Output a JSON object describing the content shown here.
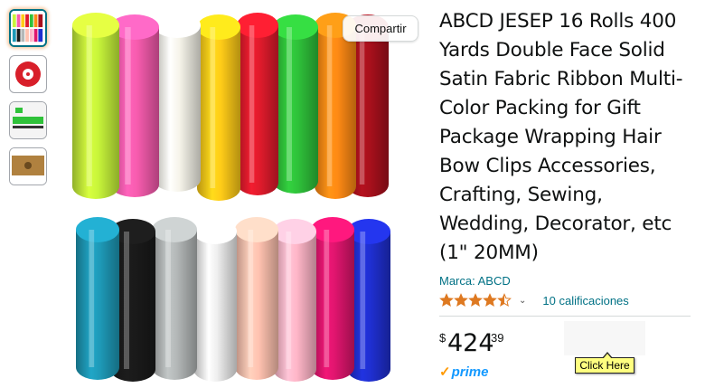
{
  "share": {
    "label": "Compartir"
  },
  "product": {
    "title": "ABCD JESEP 16 Rolls 400 Yards Double Face Solid Satin Fabric Ribbon Multi-Color Packing for Gift Package Wrapping Hair Bow Clips Accessories, Crafting, Sewing, Wedding, Decorator, etc (1\" 20MM)",
    "brand": "Marca: ABCD",
    "rating_value": 4.5,
    "rating_icon": "star-icon",
    "reviews": "10 calificaciones",
    "price_symbol": "$",
    "price_whole": "424",
    "price_fraction": "39",
    "prime_label": "prime",
    "prime_check": "✓"
  },
  "tooltip": {
    "label": "Click Here"
  },
  "thumbnails": [
    {
      "name": "thumbnail-ribbons",
      "active": true
    },
    {
      "name": "thumbnail-red-roll",
      "active": false
    },
    {
      "name": "thumbnail-ribbon-measure",
      "active": false
    },
    {
      "name": "thumbnail-package",
      "active": false
    }
  ],
  "colors": {
    "link": "#007185",
    "star": "#de7921",
    "prime": "#1399ff",
    "prime_check": "#ff9900",
    "top_rolls": [
      "#c8f53a",
      "#f75cae",
      "#f6f4ea",
      "#ffcc18",
      "#e11b2c",
      "#2fc23a",
      "#ff8a14",
      "#a8101c"
    ],
    "bottom_rolls": [
      "#1e9ab8",
      "#1a1a1a",
      "#b4b8b8",
      "#eeeeee",
      "#ffc2b0",
      "#ffb6c8",
      "#e0156e",
      "#1f2fd0"
    ]
  }
}
